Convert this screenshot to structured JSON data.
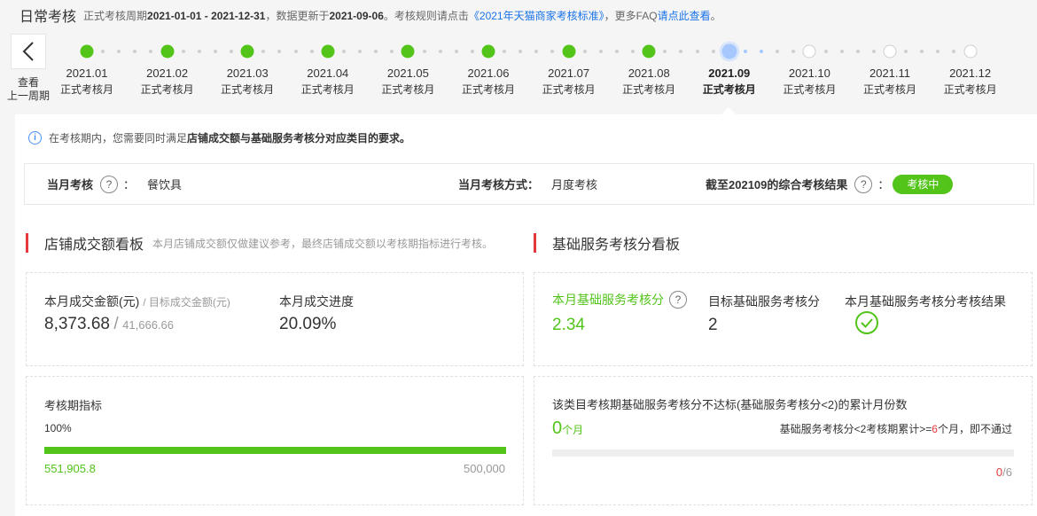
{
  "header": {
    "title": "日常考核",
    "period_prefix": "正式考核周期",
    "period": "2021-01-01 - 2021-12-31",
    "update_prefix": "，数据更新于",
    "update_date": "2021-09-06",
    "rules_prefix": "。考核规则请点击",
    "rules_link": "《2021年天猫商家考核标准》",
    "faq_prefix": "，更多FAQ",
    "faq_link": "请点此查看",
    "faq_suffix": "。"
  },
  "back": {
    "label_line1": "查看",
    "label_line2": "上一周期"
  },
  "timeline": [
    {
      "month": "2021.01",
      "label": "正式考核月",
      "state": "done"
    },
    {
      "month": "2021.02",
      "label": "正式考核月",
      "state": "done"
    },
    {
      "month": "2021.03",
      "label": "正式考核月",
      "state": "done"
    },
    {
      "month": "2021.04",
      "label": "正式考核月",
      "state": "done"
    },
    {
      "month": "2021.05",
      "label": "正式考核月",
      "state": "done"
    },
    {
      "month": "2021.06",
      "label": "正式考核月",
      "state": "done"
    },
    {
      "month": "2021.07",
      "label": "正式考核月",
      "state": "done"
    },
    {
      "month": "2021.08",
      "label": "正式考核月",
      "state": "done"
    },
    {
      "month": "2021.09",
      "label": "正式考核月",
      "state": "current"
    },
    {
      "month": "2021.10",
      "label": "正式考核月",
      "state": "future"
    },
    {
      "month": "2021.11",
      "label": "正式考核月",
      "state": "future"
    },
    {
      "month": "2021.12",
      "label": "正式考核月",
      "state": "future"
    }
  ],
  "notice": {
    "icon": "info-icon",
    "text_prefix": "在考核期内，您需要同时满足",
    "text_bold": "店铺成交额与基础服务考核分对应类目的要求。"
  },
  "summary": {
    "month_label": "当月考核",
    "month_sep": "：",
    "category": "餐饮具",
    "method_label": "当月考核方式：",
    "method_value": "月度考核",
    "result_label": "截至202109的综合考核结果",
    "result_sep": "：",
    "result_badge": "考核中"
  },
  "sales": {
    "title": "店铺成交额看板",
    "note": "本月店铺成交额仅做建议参考，最终店铺成交额以考核期指标进行考核。",
    "amount_label": "本月成交金额(元)",
    "target_label": "/ 目标成交金额(元)",
    "amount": "8,373.68",
    "slash": "/",
    "target": "41,666.66",
    "progress_label": "本月成交进度",
    "progress": "20.09%",
    "period_label": "考核期指标",
    "period_percent": "100%",
    "period_fill": 1.0,
    "period_actual": "551,905.8",
    "period_target": "500,000"
  },
  "service": {
    "title": "基础服务考核分看板",
    "score_label": "本月基础服务考核分",
    "score": "2.34",
    "target_label": "目标基础服务考核分",
    "target": "2",
    "result_label": "本月基础服务考核分考核结果",
    "result_icon": "check-circle-icon",
    "fail_label": "该类目考核期基础服务考核分不达标(基础服务考核分<2)的累计月份数",
    "fail_count": "0",
    "fail_unit": "个月",
    "rule_prefix": "基础服务考核分<2考核期累计>=",
    "rule_num": "6",
    "rule_suffix": "个月，即不通过",
    "fraction_num": "0",
    "fraction_den": "/6",
    "fail_fill": 0
  },
  "colors": {
    "green": "#52c41a",
    "red": "#e4393c",
    "blue_link": "#1a73e8",
    "current_dot": "#a6c8ff"
  }
}
